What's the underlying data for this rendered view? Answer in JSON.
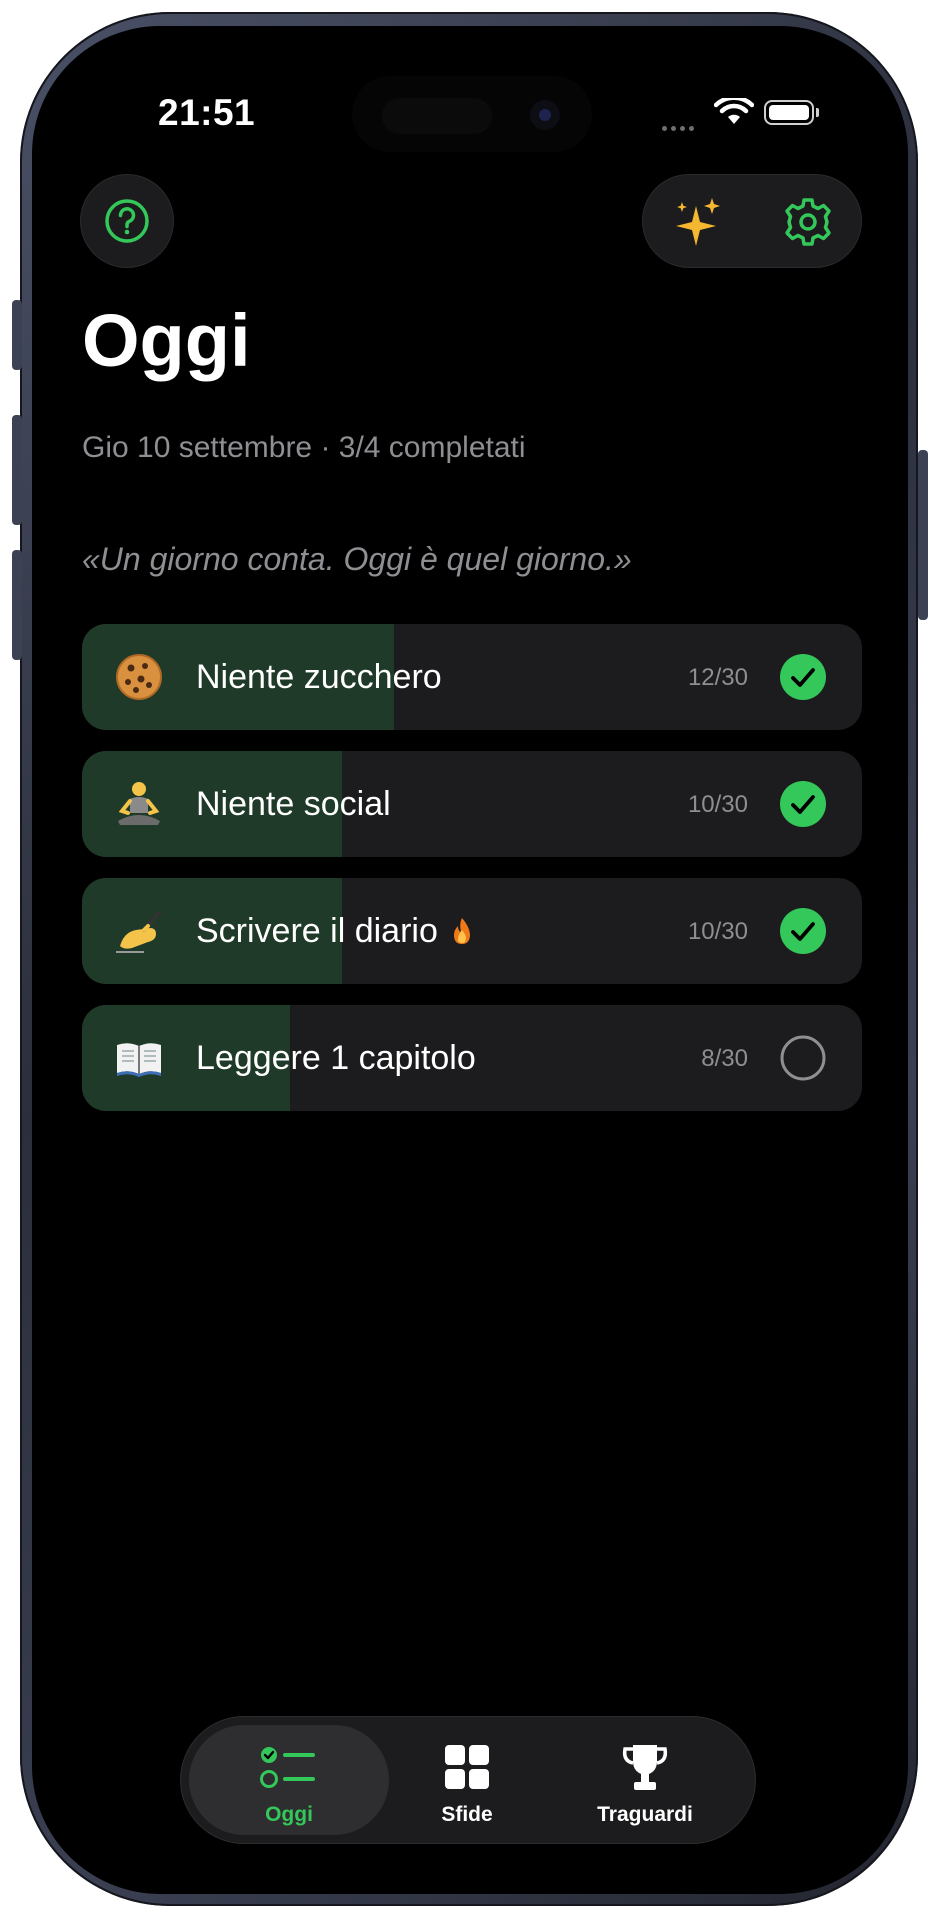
{
  "status_bar": {
    "time": "21:51"
  },
  "header": {
    "title": "Oggi",
    "subtitle": "Gio 10 settembre · 3/4 completati",
    "quote": "«Un giorno conta. Oggi è quel giorno.»"
  },
  "icons": {
    "help": "question-circle-icon",
    "ai": "sparkles-icon",
    "settings": "gear-icon"
  },
  "colors": {
    "accent": "#34c759",
    "progress": "#1f3a28",
    "card": "#1c1c1e",
    "sparkle": "#f5b730"
  },
  "habits": [
    {
      "emoji": "cookie",
      "label": "Niente zucchero",
      "count": "12/30",
      "progress": 0.4,
      "done": true,
      "streak": false
    },
    {
      "emoji": "person-meditating",
      "label": "Niente social",
      "count": "10/30",
      "progress": 0.333,
      "done": true,
      "streak": false
    },
    {
      "emoji": "writing-hand",
      "label": "Scrivere il diario",
      "count": "10/30",
      "progress": 0.333,
      "done": true,
      "streak": true
    },
    {
      "emoji": "open-book",
      "label": "Leggere 1 capitolo",
      "count": "8/30",
      "progress": 0.267,
      "done": false,
      "streak": false
    }
  ],
  "tabs": [
    {
      "label": "Oggi",
      "icon": "checklist-icon",
      "active": true
    },
    {
      "label": "Sfide",
      "icon": "grid-icon",
      "active": false
    },
    {
      "label": "Traguardi",
      "icon": "trophy-icon",
      "active": false
    }
  ]
}
